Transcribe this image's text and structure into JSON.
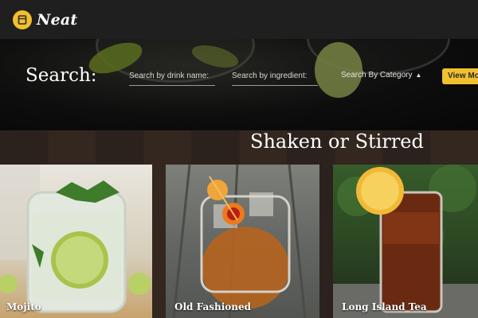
{
  "brand": {
    "name": "Neat"
  },
  "search": {
    "title": "Search:",
    "drink_placeholder": "Search by drink name:",
    "ingredient_placeholder": "Search by ingredient:",
    "category_label": "Search By Category",
    "category_icon": "sort-arrows-icon",
    "button_label": "View More"
  },
  "section": {
    "title": "Shaken or Stirred",
    "cards": [
      {
        "label": "Mojito"
      },
      {
        "label": "Old Fashioned"
      },
      {
        "label": "Long Island Tea"
      }
    ]
  },
  "colors": {
    "accent": "#f0c02f",
    "topbar": "#1f1f1f"
  }
}
